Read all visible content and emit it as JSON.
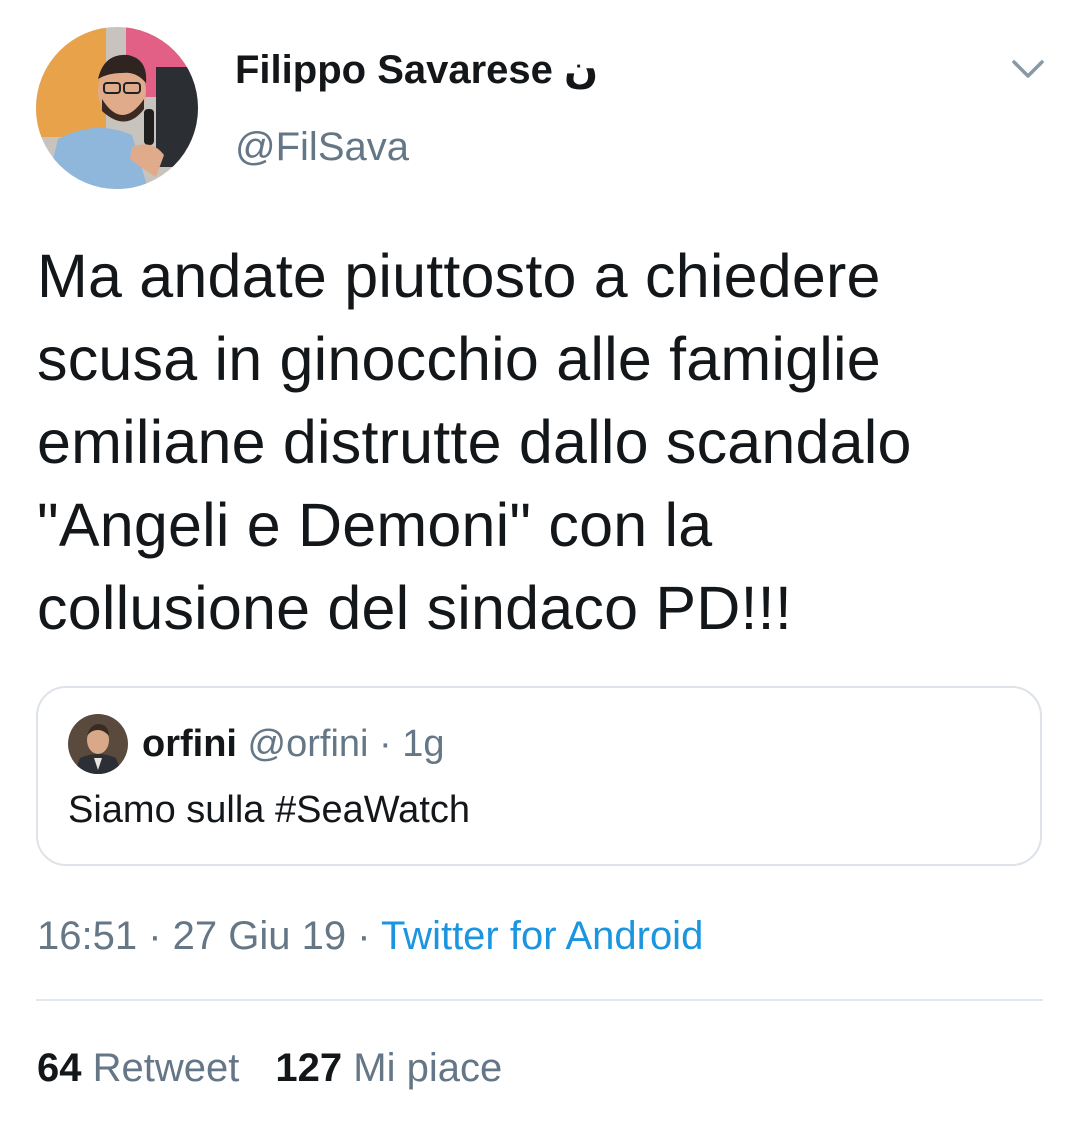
{
  "tweet": {
    "author": {
      "name": "Filippo Savarese",
      "name_suffix": "ن",
      "handle": "@FilSava"
    },
    "text": "Ma andate piuttosto a chiedere\nscusa in ginocchio alle famiglie\nemiliane distrutte dallo scandalo\n\"Angeli e Demoni\" con la\ncollusione del sindaco PD!!!",
    "quoted": {
      "name": "orfini",
      "handle": "@orfini",
      "separator": " · ",
      "age": "1g",
      "text": "Siamo sulla #SeaWatch"
    },
    "meta": {
      "time": "16:51",
      "separator": " · ",
      "date": "27 Giu 19",
      "source": "Twitter for Android"
    },
    "stats": {
      "retweets_count": "64",
      "retweets_label": "Retweet",
      "likes_count": "127",
      "likes_label": "Mi piace"
    }
  },
  "icons": {
    "menu": "chevron-down-icon"
  },
  "colors": {
    "text_primary": "#14171a",
    "text_secondary": "#657786",
    "link": "#1b95e0",
    "border": "#dde3e8"
  }
}
